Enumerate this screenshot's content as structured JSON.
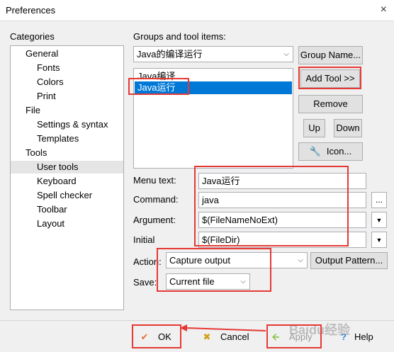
{
  "window": {
    "title": "Preferences",
    "close_icon": "×"
  },
  "categories": {
    "label": "Categories",
    "items": [
      "General",
      "Fonts",
      "Colors",
      "Print",
      "File",
      "Settings & syntax",
      "Templates",
      "Tools",
      "User tools",
      "Keyboard",
      "Spell checker",
      "Toolbar",
      "Layout"
    ],
    "selected": "User tools"
  },
  "groups": {
    "label": "Groups and tool items:",
    "selected_group": "Java的编译运行",
    "group_name_button": "Group Name...",
    "items": [
      "Java编译",
      "Java运行"
    ],
    "selected_item": "Java运行"
  },
  "buttons": {
    "add_tool": "Add Tool >>",
    "remove": "Remove",
    "up": "Up",
    "down": "Down",
    "icon": "Icon..."
  },
  "form": {
    "menu_text_label": "Menu text:",
    "menu_text_value": "Java运行",
    "command_label": "Command:",
    "command_value": "java",
    "command_browse": "...",
    "argument_label": "Argument:",
    "argument_value": "$(FileNameNoExt)",
    "initial_label": "Initial",
    "initial_value": "$(FileDir)",
    "action_label": "Action:",
    "action_value": "Capture output",
    "output_pattern_button": "Output Pattern...",
    "save_label": "Save:",
    "save_value": "Current file"
  },
  "footer": {
    "ok": "OK",
    "cancel": "Cancel",
    "apply": "Apply",
    "help": "Help",
    "watermark": "Baidu经验"
  },
  "colors": {
    "accent": "#0078d7",
    "highlight_red": "#e53935"
  }
}
